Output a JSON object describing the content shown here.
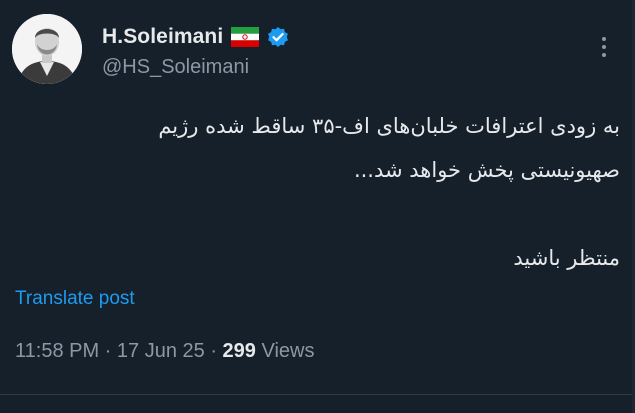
{
  "user": {
    "display_name": "H.Soleimani",
    "handle": "@HS_Soleimani",
    "flag_icon": "iran-flag-icon",
    "verified_icon": "verified-badge-icon",
    "verified_color": "#1d9bf0"
  },
  "menu": {
    "icon": "more-vertical-icon"
  },
  "tweet": {
    "lines": [
      "به زودی اعترافات خلبان‌های اف-۳۵ ساقط شده رژیم",
      "صهیونیستی پخش خواهد شد...",
      "منتظر باشید"
    ]
  },
  "translate": {
    "label": "Translate post"
  },
  "meta": {
    "time": "11:58 PM",
    "separator": " · ",
    "date": "17 Jun 25",
    "views_count": "299",
    "views_label": " Views"
  },
  "colors": {
    "background": "#15202b",
    "text_primary": "#e7e9ea",
    "text_secondary": "#8b98a5",
    "accent": "#1d9bf0"
  }
}
